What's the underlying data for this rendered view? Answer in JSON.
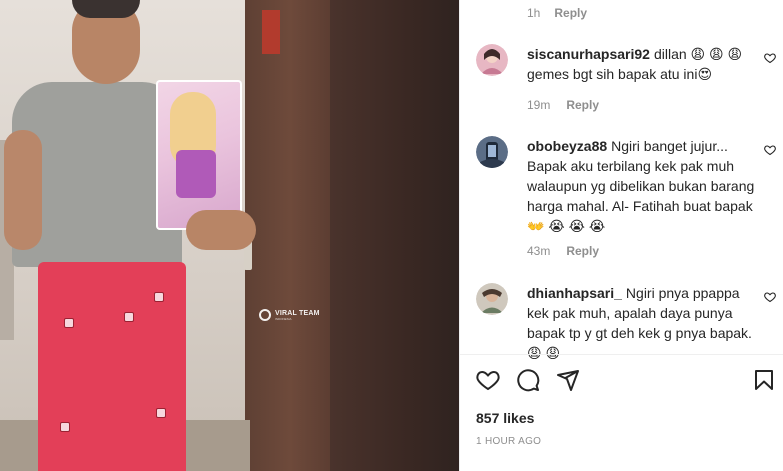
{
  "comments_panel": {
    "previous_comment_meta": {
      "time": "1h",
      "reply_label": "Reply"
    },
    "comments": [
      {
        "username": "siscanurhapsari92",
        "text": "dillan 😩 😩 😩 gemes bgt sih bapak atu ini😍",
        "time": "19m",
        "reply_label": "Reply"
      },
      {
        "username": "obobeyza88",
        "text": "Ngiri banget jujur... Bapak aku terbilang kek pak muh walaupun yg dibelikan bukan barang harga mahal. Al- Fatihah buat bapak 👐 😭 😭 😭",
        "time": "43m",
        "reply_label": "Reply"
      },
      {
        "username": "dhianhapsari_",
        "text": "Ngiri pnya ppappa kek pak muh, apalah daya punya bapak tp y gt deh kek g pnya bapak. 😩 😩",
        "time": "",
        "reply_label": ""
      }
    ],
    "actions": {
      "like_icon": "heart-icon",
      "comment_icon": "comment-icon",
      "share_icon": "share-icon",
      "save_icon": "bookmark-icon"
    },
    "likes": "857 likes",
    "post_time": "1 HOUR AGO"
  },
  "media": {
    "watermark_title": "VIRAL TEAM",
    "watermark_subtitle": "INDONESIA"
  },
  "colors": {
    "text_primary": "#262626",
    "text_muted": "#8e8e8e",
    "divider": "#efefef",
    "sarong": "#e33f58"
  }
}
